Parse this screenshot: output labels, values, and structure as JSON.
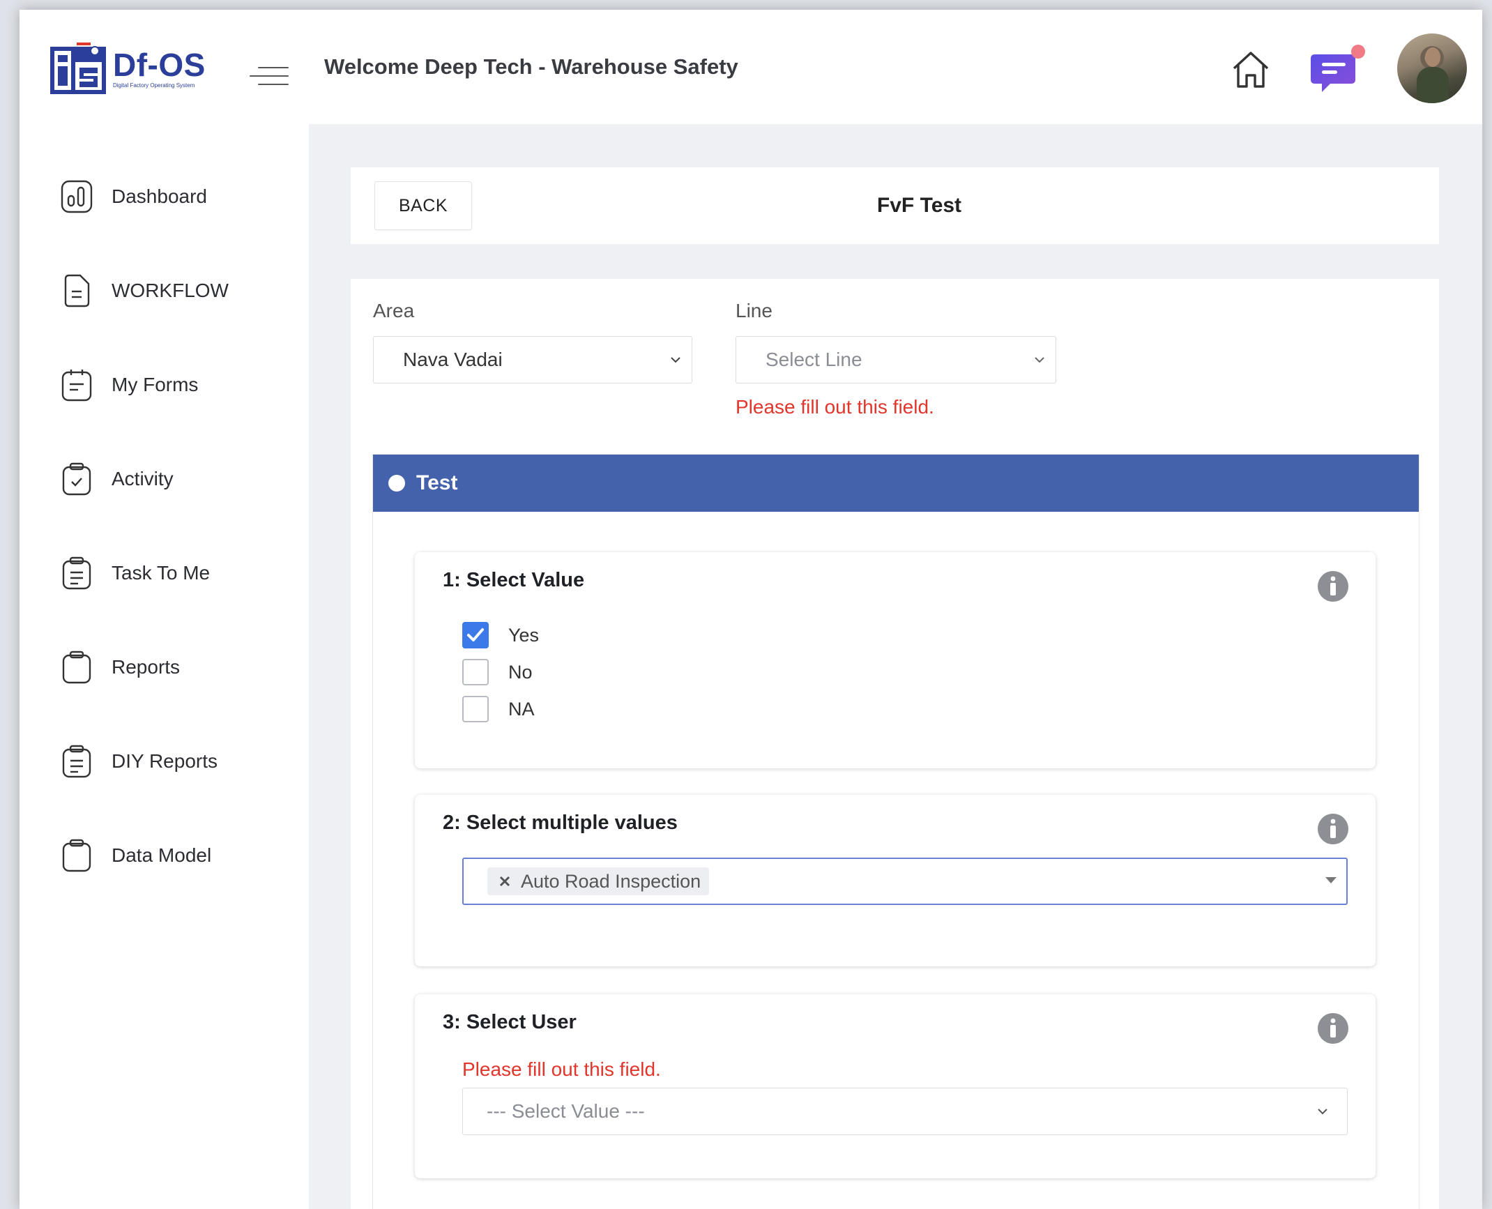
{
  "app": {
    "logo_title": "Df-OS",
    "logo_subtitle": "Digital Factory Operating System",
    "header_title": "Welcome Deep Tech - Warehouse Safety"
  },
  "sidebar": {
    "items": [
      {
        "label": "Dashboard",
        "icon": "dashboard-icon"
      },
      {
        "label": "WORKFLOW",
        "icon": "document-icon"
      },
      {
        "label": "My Forms",
        "icon": "forms-icon"
      },
      {
        "label": "Activity",
        "icon": "clipboard-check-icon"
      },
      {
        "label": "Task To Me",
        "icon": "clipboard-list-icon"
      },
      {
        "label": "Reports",
        "icon": "clipboard-icon"
      },
      {
        "label": "DIY Reports",
        "icon": "clipboard-list-icon"
      },
      {
        "label": "Data Model",
        "icon": "clipboard-icon"
      }
    ]
  },
  "toolbar": {
    "back_label": "BACK",
    "form_title": "FvF Test"
  },
  "filters": {
    "area_label": "Area",
    "area_value": "Nava Vadai",
    "line_label": "Line",
    "line_placeholder": "Select Line",
    "line_error": "Please fill out this field."
  },
  "section": {
    "title": "Test",
    "header_color": "#4462ab"
  },
  "questions": {
    "q1": {
      "title": "1: Select Value",
      "options": [
        {
          "label": "Yes",
          "checked": true
        },
        {
          "label": "No",
          "checked": false
        },
        {
          "label": "NA",
          "checked": false
        }
      ]
    },
    "q2": {
      "title": "2: Select multiple values",
      "selected": [
        "Auto Road Inspection"
      ]
    },
    "q3": {
      "title": "3: Select User",
      "error": "Please fill out this field.",
      "placeholder": "--- Select Value ---"
    }
  },
  "colors": {
    "accent": "#4462ab",
    "error": "#e0362c",
    "checkbox": "#3b7ae8",
    "notification_dot": "#f07b86"
  }
}
